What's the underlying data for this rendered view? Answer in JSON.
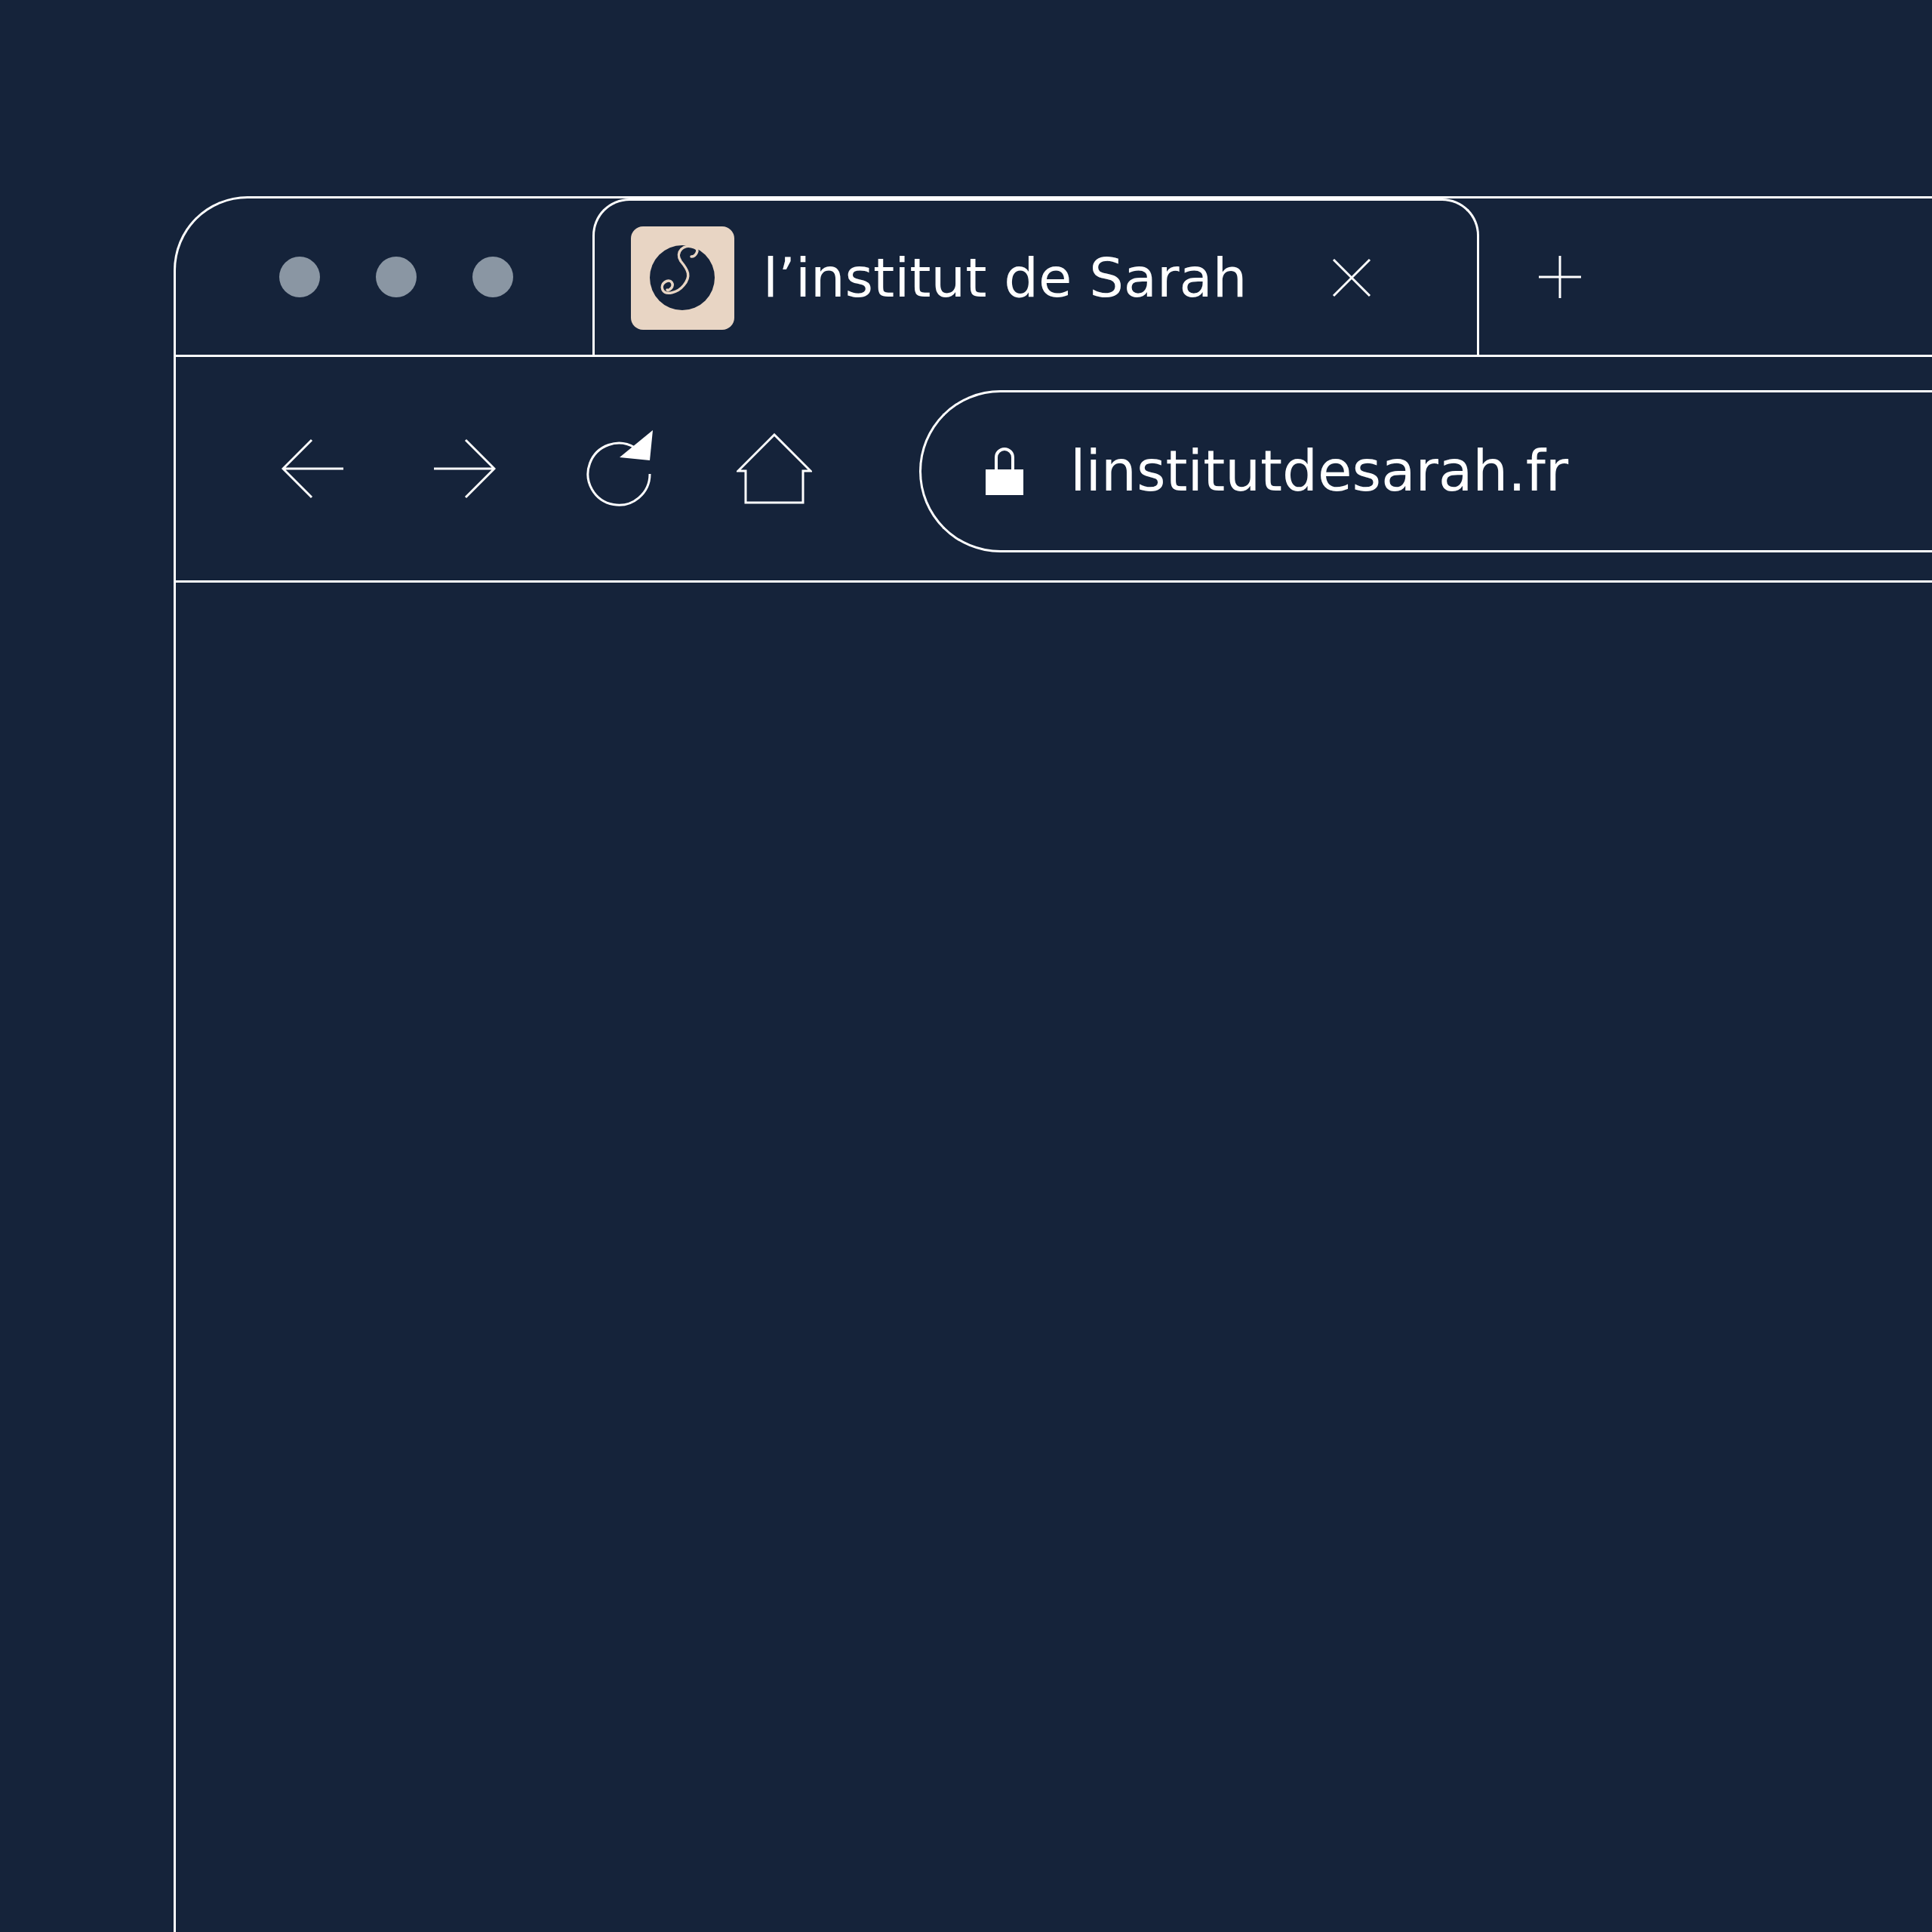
{
  "window_controls": [
    {
      "kind": "dot"
    },
    {
      "kind": "dot"
    },
    {
      "kind": "dot"
    }
  ],
  "tabs": [
    {
      "title": "l’institut de Sarah",
      "selected": true
    }
  ],
  "address_bar": {
    "url": "linstitutdesarah.fr",
    "secure": true
  }
}
